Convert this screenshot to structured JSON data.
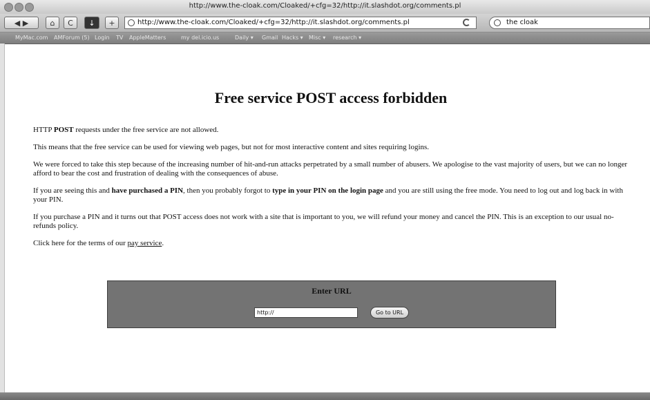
{
  "window": {
    "title": "http://www.the-cloak.com/Cloaked/+cfg=32/http://it.slashdot.org/comments.pl"
  },
  "toolbar": {
    "back_forward": "◀ ▶",
    "home_glyph": "⌂",
    "snapback_glyph": "C",
    "download_glyph": "↓",
    "add_glyph": "+",
    "address": "http://www.the-cloak.com/Cloaked/+cfg=32/http://it.slashdot.org/comments.pl",
    "search_value": "the cloak"
  },
  "bookmarks": [
    "MyMac.com",
    "AMForum (5)",
    "Login",
    "TV",
    "AppleMatters",
    "my del.icio.us",
    "Daily ▾",
    "Gmail",
    "Hacks ▾",
    "Misc ▾",
    "research ▾"
  ],
  "page": {
    "heading": "Free service POST access forbidden",
    "p1_a": "HTTP ",
    "p1_b": "POST",
    "p1_c": " requests under the free service are not allowed.",
    "p2": "This means that the free service can be used for viewing web pages, but not for most interactive content and sites requiring logins.",
    "p3": "We were forced to take this step because of the increasing number of hit-and-run attacks perpetrated by a small number of abusers. We apologise to the vast majority of users, but we can no longer afford to bear the cost and frustration of dealing with the consequences of abuse.",
    "p4_a": "If you are seeing this and ",
    "p4_b": "have purchased a PIN",
    "p4_c": ", then you probably forgot to ",
    "p4_d": "type in your PIN on the login page",
    "p4_e": " and you are still using the free mode. You need to log out and log back in with your PIN.",
    "p5": "If you purchase a PIN and it turns out that POST access does not work with a site that is important to you, we will refund your money and cancel the PIN. This is an exception to our usual no-refunds policy.",
    "p6_a": "Click here for the terms of our ",
    "p6_link": "pay service",
    "p6_b": "."
  },
  "url_form": {
    "title": "Enter URL",
    "input_value": "http://",
    "button_label": "Go to URL"
  },
  "colors": {
    "panel_background": "#737373",
    "link": "#111111"
  }
}
